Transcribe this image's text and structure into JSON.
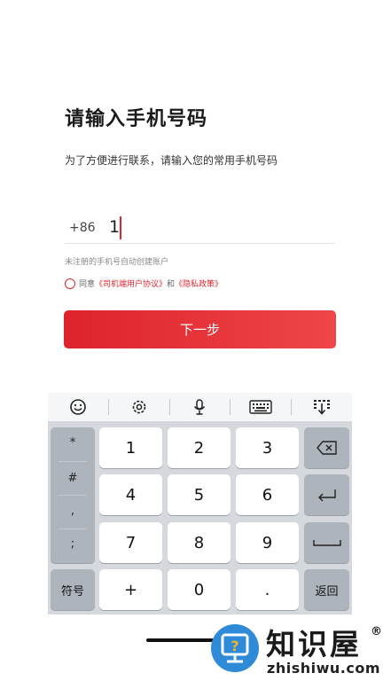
{
  "login": {
    "title": "请输入手机号码",
    "subtitle": "为了方便进行联系，请输入您的常用手机号码",
    "country_code": "+86",
    "phone_value": "1",
    "hint": "未注册的手机号自动创建账户",
    "agree_prefix": "同意",
    "terms_link": "《司机端用户协议》",
    "and_text": "和",
    "privacy_link": "《隐私政策》",
    "next_label": "下一步"
  },
  "keyboard": {
    "toolbar": [
      "emoji-icon",
      "settings-icon",
      "microphone-icon",
      "keyboard-icon",
      "collapse-keyboard-icon"
    ],
    "symbols": [
      "*",
      "#",
      ",",
      ";"
    ],
    "keys": [
      "1",
      "2",
      "3",
      "4",
      "5",
      "6",
      "7",
      "8",
      "9",
      "+",
      "0",
      "."
    ],
    "symbol_key": "符号",
    "return_key": "返回",
    "icons": {
      "backspace": "backspace-icon",
      "enter": "enter-icon",
      "space": "space-icon"
    }
  },
  "watermark": {
    "brand": "知识屋",
    "registered": "®",
    "url": "zhishiwu.com",
    "logo_glyph": "?"
  },
  "colors": {
    "accent": "#e0262f",
    "keyboard_bg": "#d5d8dd",
    "function_key": "#aeb4bc",
    "watermark_blue": "#2f8ad8"
  }
}
